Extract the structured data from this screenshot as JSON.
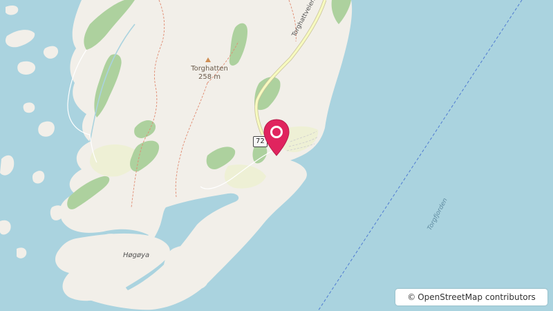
{
  "map": {
    "peak_name": "Torghatten",
    "peak_elevation": "258 m",
    "island_name": "Høgøya",
    "road_name": "Torghattveien",
    "road_number": "72",
    "water_name": "Torgfjorden",
    "marker": {
      "type": "location-pin",
      "color": "#e0245e"
    }
  },
  "attribution": {
    "symbol": "©",
    "text": "OpenStreetMap contributors"
  },
  "colors": {
    "water": "#aad3df",
    "land": "#f2efe9",
    "forest": "#add19e",
    "farmland": "#eef0d5",
    "road": "#f7fabf",
    "path": "#e08a70",
    "boundary": "#4f7bd1"
  }
}
